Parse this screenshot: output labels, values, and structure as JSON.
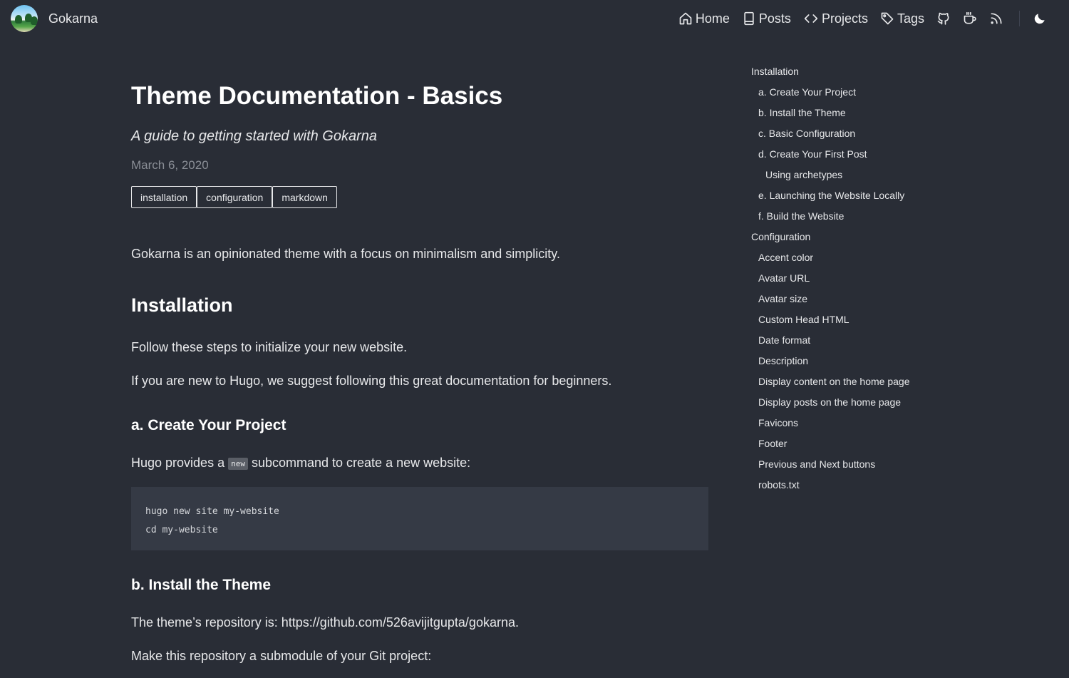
{
  "header": {
    "site_name": "Gokarna",
    "nav": [
      {
        "label": "Home",
        "icon": "home-icon"
      },
      {
        "label": "Posts",
        "icon": "book-icon"
      },
      {
        "label": "Projects",
        "icon": "code-icon"
      },
      {
        "label": "Tags",
        "icon": "tag-icon"
      }
    ],
    "icon_links": [
      "github-icon",
      "coffee-icon",
      "rss-icon"
    ],
    "theme_toggle_icon": "moon-icon"
  },
  "post": {
    "title": "Theme Documentation - Basics",
    "subtitle": "A guide to getting started with Gokarna",
    "date": "March 6, 2020",
    "tags": [
      "installation",
      "configuration",
      "markdown"
    ],
    "intro": "Gokarna is an opinionated theme with a focus on minimalism and simplicity.",
    "h_installation": "Installation",
    "follow_steps": "Follow these steps to initialize your new website.",
    "new_to_prefix": "If you are new to ",
    "hugo_link": "Hugo",
    "new_to_mid": ", we suggest following this ",
    "docs_link": "great documentation for beginners",
    "new_to_suffix": ".",
    "h_create": "a. Create Your Project",
    "hugo_provides_prefix": "Hugo provides a ",
    "inline_code_new": "new",
    "hugo_provides_suffix": " subcommand to create a new website:",
    "code_lines": [
      "hugo new site my-website",
      "cd my-website"
    ],
    "h_install_theme": "b. Install the Theme",
    "repo_prefix": "The theme’s repository is: ",
    "repo_link": "https://github.com/526avijitgupta/gokarna",
    "repo_suffix": ".",
    "submodule_text": "Make this repository a submodule of your Git project:"
  },
  "toc": [
    {
      "label": "Installation",
      "level": 1
    },
    {
      "label": "a. Create Your Project",
      "level": 2
    },
    {
      "label": "b. Install the Theme",
      "level": 2
    },
    {
      "label": "c. Basic Configuration",
      "level": 2
    },
    {
      "label": "d. Create Your First Post",
      "level": 2
    },
    {
      "label": "Using archetypes",
      "level": 3
    },
    {
      "label": "e. Launching the Website Locally",
      "level": 2
    },
    {
      "label": "f. Build the Website",
      "level": 2
    },
    {
      "label": "Configuration",
      "level": 1
    },
    {
      "label": "Accent color",
      "level": 2
    },
    {
      "label": "Avatar URL",
      "level": 2
    },
    {
      "label": "Avatar size",
      "level": 2
    },
    {
      "label": "Custom Head HTML",
      "level": 2
    },
    {
      "label": "Date format",
      "level": 2
    },
    {
      "label": "Description",
      "level": 2
    },
    {
      "label": "Display content on the home page",
      "level": 2
    },
    {
      "label": "Display posts on the home page",
      "level": 2
    },
    {
      "label": "Favicons",
      "level": 2
    },
    {
      "label": "Footer",
      "level": 2
    },
    {
      "label": "Previous and Next buttons",
      "level": 2
    },
    {
      "label": "robots.txt",
      "level": 2
    }
  ],
  "colors": {
    "background": "#292d36",
    "text": "#e7e8ea",
    "code_background": "#353a45"
  }
}
